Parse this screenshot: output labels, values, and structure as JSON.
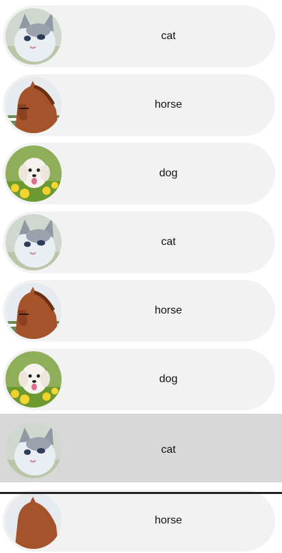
{
  "list": {
    "items": [
      {
        "label": "cat",
        "icon": "cat-photo"
      },
      {
        "label": "horse",
        "icon": "horse-photo"
      },
      {
        "label": "dog",
        "icon": "dog-photo"
      },
      {
        "label": "cat",
        "icon": "cat-photo"
      },
      {
        "label": "horse",
        "icon": "horse-photo"
      },
      {
        "label": "dog",
        "icon": "dog-photo"
      },
      {
        "label": "cat",
        "icon": "cat-photo",
        "selected": true
      },
      {
        "label": "horse",
        "icon": "horse-photo"
      }
    ]
  },
  "colors": {
    "pill": "#f2f2f2",
    "selected_row": "#d8d8d8",
    "text": "#111111"
  }
}
